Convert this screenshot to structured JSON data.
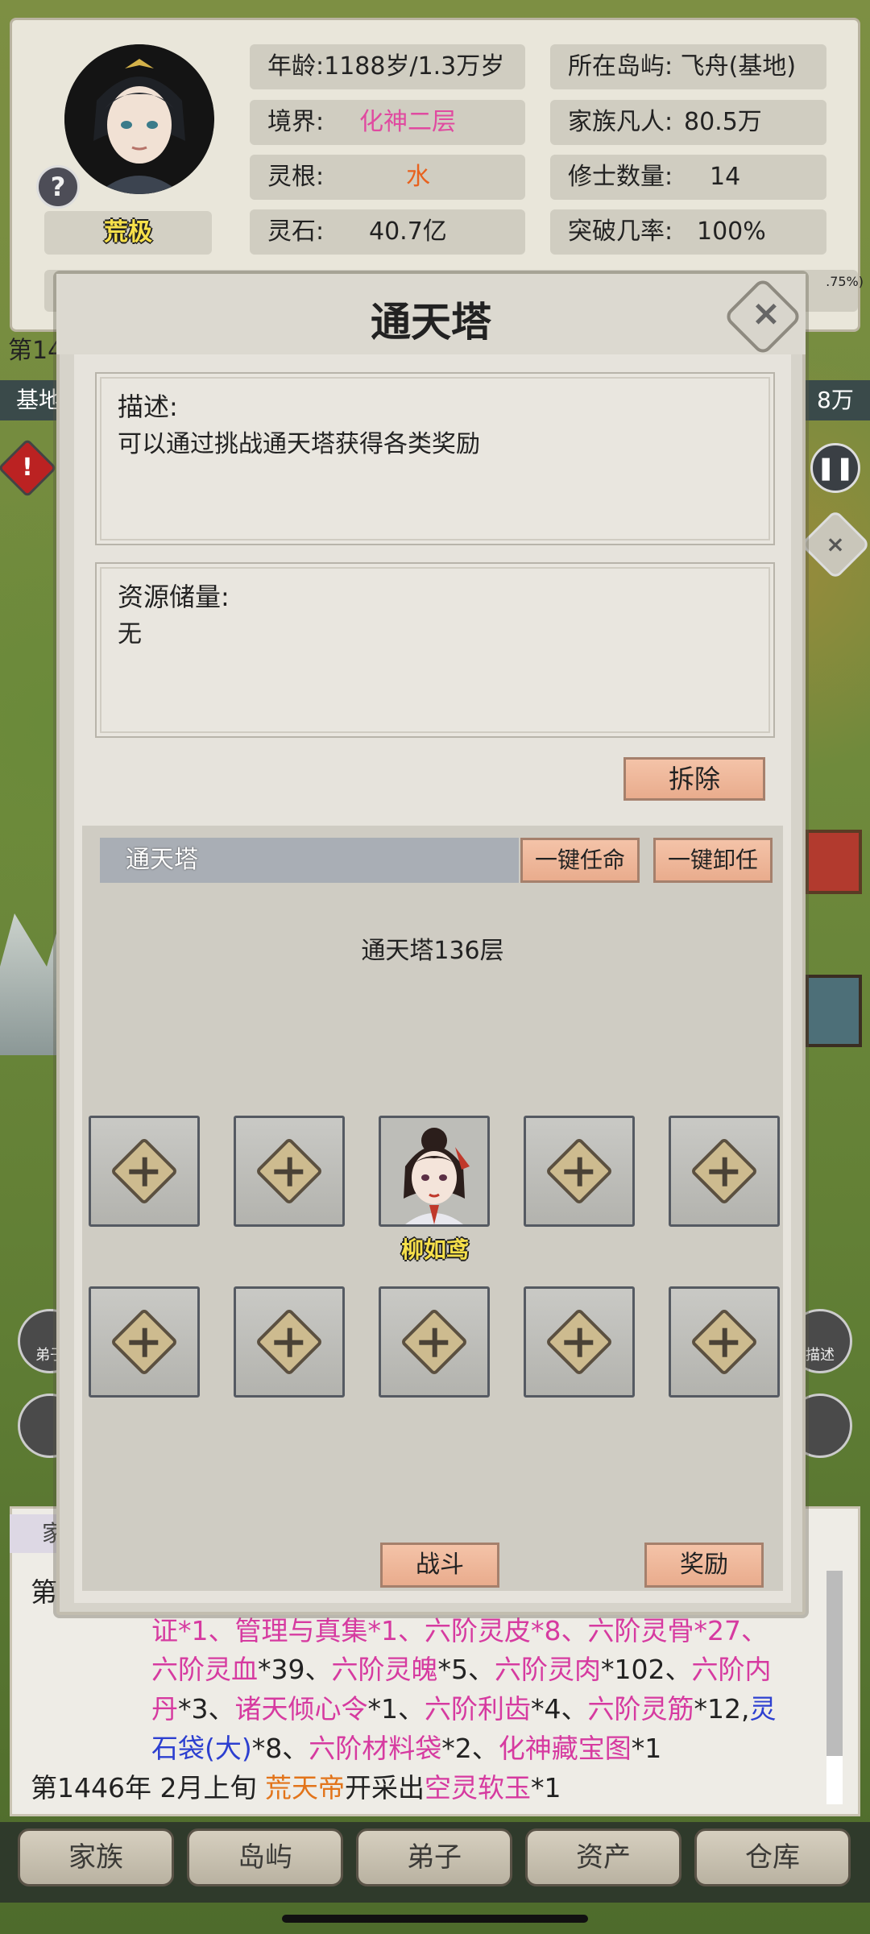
{
  "profile": {
    "rank": "荒极",
    "help_icon": "?",
    "stats": {
      "age_label": "年龄:",
      "age_value": "1188岁/1.3万岁",
      "island_label": "所在岛屿:",
      "island_value": "飞舟(基地)",
      "realm_label": "境界:",
      "realm_value": "化神二层",
      "mortals_label": "家族凡人:",
      "mortals_value": "80.5万",
      "root_label": "灵根:",
      "root_value": "水",
      "cultivators_label": "修士数量:",
      "cultivators_value": "14",
      "stones_label": "灵石:",
      "stones_value": "40.7亿",
      "breakthrough_label": "突破几率:",
      "breakthrough_value": "100%"
    },
    "partial_pct": ".75%)",
    "partial_year": "第14",
    "partial_base": "基地",
    "partial_right": "8万"
  },
  "modal": {
    "title": "通天塔",
    "close_icon": "×",
    "description_label": "描述:",
    "description_text": "可以通过挑战通天塔获得各类奖励",
    "resource_label": "资源储量:",
    "resource_text": "无",
    "demolish_label": "拆除",
    "tower_name": "通天塔",
    "appoint_all_label": "一键任命",
    "dismiss_all_label": "一键卸任",
    "floor_text": "通天塔136层",
    "character_name": "柳如鸢",
    "battle_label": "战斗",
    "reward_label": "奖励"
  },
  "log": {
    "tab_label": "家",
    "first_prefix": "第",
    "line1": "证*1、管理与真集*1、六阶灵皮*8、六阶灵骨*27、",
    "line2_a": "六阶灵血",
    "line2_b": "*39、",
    "line2_c": "六阶灵魄",
    "line2_d": "*5、",
    "line2_e": "六阶灵肉",
    "line2_f": "*102、",
    "line2_g": "六阶内",
    "line3_a": "丹",
    "line3_b": "*3、",
    "line3_c": "诸天倾心令",
    "line3_d": "*1、",
    "line3_e": "六阶利齿",
    "line3_f": "*4、",
    "line3_g": "六阶灵筋",
    "line3_h": "*12,",
    "line3_i": "灵",
    "line4_a": "石袋(大)",
    "line4_b": "*8、",
    "line4_c": "六阶材料袋",
    "line4_d": "*2、",
    "line4_e": "化神藏宝图",
    "line4_f": "*1",
    "line5_a": "第1446年 2月上旬 ",
    "line5_b": "荒天帝",
    "line5_c": "开采出",
    "line5_d": "空灵软玉",
    "line5_e": "*1"
  },
  "side": {
    "alert_icon": "!",
    "pause_icon": "❚❚",
    "close_icon": "×",
    "disciple_label": "弟子",
    "describe_label": "描述"
  },
  "nav": {
    "items": [
      "家族",
      "岛屿",
      "弟子",
      "资产",
      "仓库"
    ]
  },
  "colors": {
    "realm": "#e04aa0",
    "root": "#e8621e",
    "item_pink": "#d63aa0",
    "item_blue": "#2c3fd0",
    "player_orange": "#e2741a",
    "name_yellow": "#f7e04a"
  }
}
